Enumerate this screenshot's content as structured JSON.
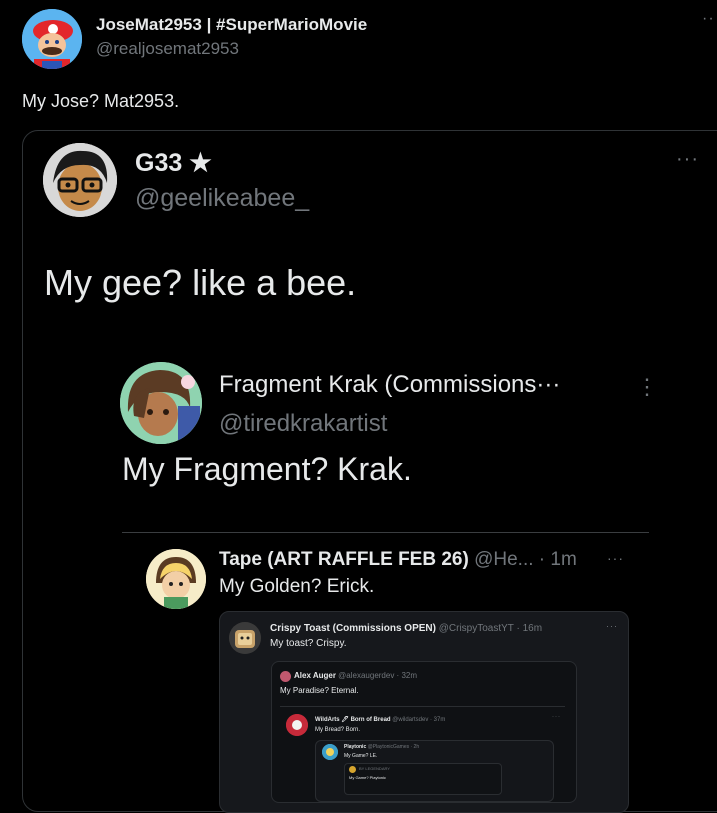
{
  "main_tweet": {
    "name": "JoseMat2953 | #SuperMarioMovie",
    "handle": "@realjosemat2953",
    "text": "My Jose? Mat2953.",
    "more": "··"
  },
  "quote1": {
    "name": "G33 ★",
    "handle": "@geelikeabee_",
    "text": "My gee? like a bee.",
    "more": "···"
  },
  "quote2": {
    "name": "Fragment Krak (Commissions···",
    "handle": "@tiredkrakartist",
    "text": "My Fragment? Krak.",
    "more": "⋮"
  },
  "quote3": {
    "name": "Tape (ART RAFFLE FEB 26)",
    "meta": "@He... · 1m",
    "text": "My Golden? Erick.",
    "more": "···"
  },
  "quote4": {
    "name": "Crispy Toast (Commissions OPEN)",
    "meta": "@CrispyToastYT · 16m",
    "text": "My toast? Crispy.",
    "more": "···"
  },
  "quote5": {
    "name": "Alex Auger",
    "meta": "@alexaugerdev · 32m",
    "text": "My Paradise? Eternal."
  },
  "quote6": {
    "name": "WildArts 🖊 Born of Bread",
    "meta": "@wildartsdev · 37m",
    "text": "My Bread? Born.",
    "more": "···"
  },
  "quote7": {
    "name": "Playtonic",
    "meta": "@PlaytonicGames · 2h",
    "text": "My Game? LE."
  },
  "quote8": {
    "line1": "BY LEGENDARY",
    "line2": "My Game? Playtonic"
  },
  "colors": {
    "bg": "#000000",
    "text": "#e7e9ea",
    "muted": "#71767b",
    "border": "#2f3336",
    "inner_bg": "#16181c"
  }
}
